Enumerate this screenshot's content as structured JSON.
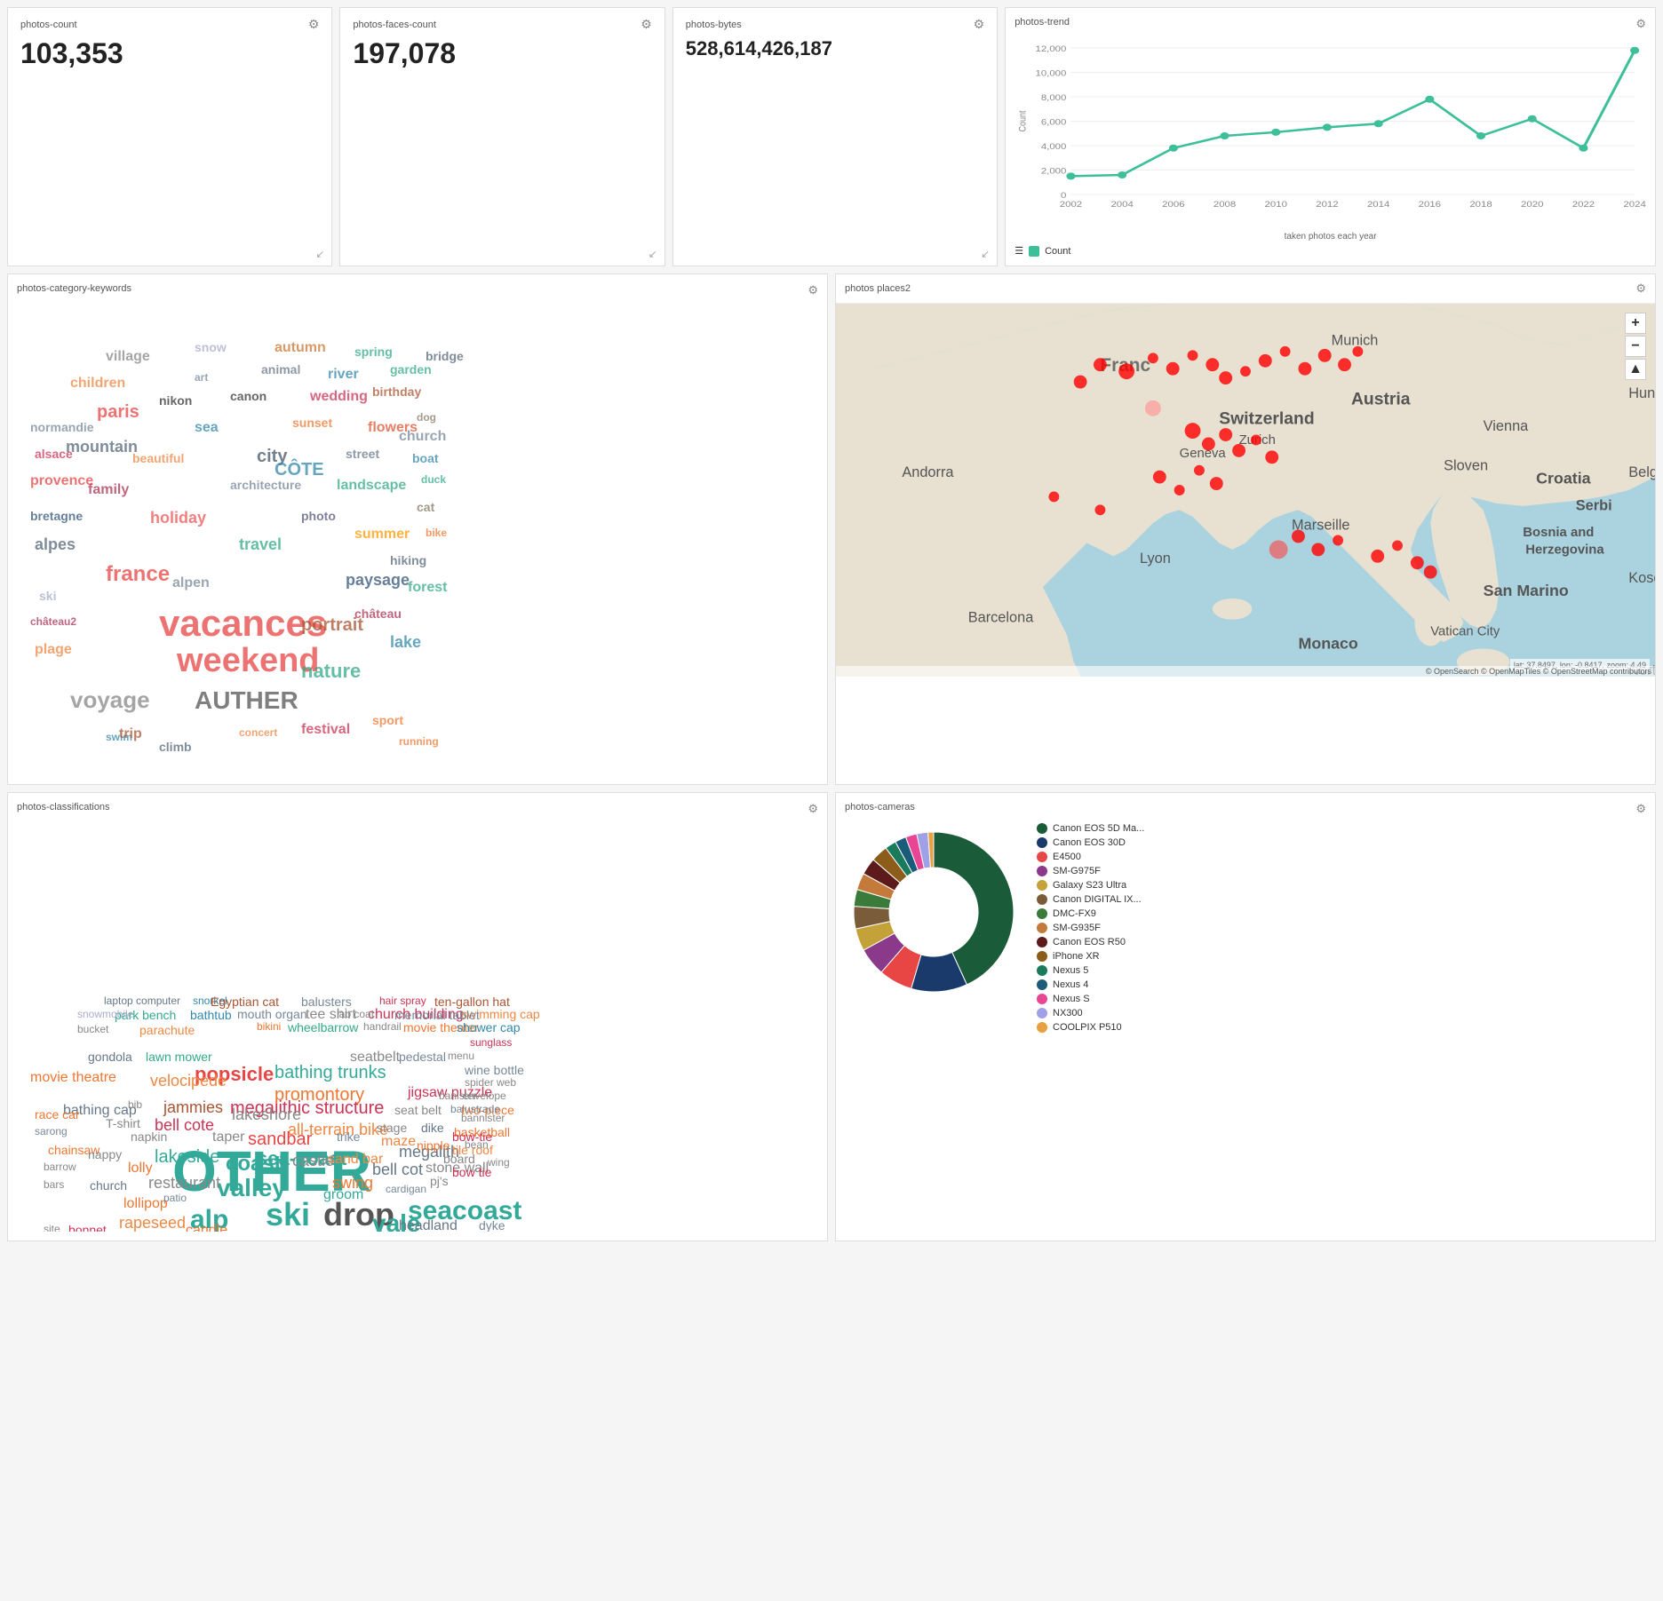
{
  "stats": {
    "photos_count": {
      "title": "photos-count",
      "value": "103,353"
    },
    "photos_faces_count": {
      "title": "photos-faces-count",
      "value": "197,078"
    },
    "photos_bytes": {
      "title": "photos-bytes",
      "value": "528,614,426,187"
    }
  },
  "trend": {
    "title": "photos-trend",
    "x_label": "taken photos each year",
    "y_label": "Count",
    "legend": "Count",
    "data": [
      {
        "year": 2002,
        "count": 1500
      },
      {
        "year": 2004,
        "count": 1600
      },
      {
        "year": 2006,
        "count": 3800
      },
      {
        "year": 2008,
        "count": 4800
      },
      {
        "year": 2010,
        "count": 5100
      },
      {
        "year": 2012,
        "count": 5500
      },
      {
        "year": 2014,
        "count": 5800
      },
      {
        "year": 2016,
        "count": 7800
      },
      {
        "year": 2018,
        "count": 4800
      },
      {
        "year": 2020,
        "count": 6200
      },
      {
        "year": 2022,
        "count": 3800
      },
      {
        "year": 2024,
        "count": 11800
      }
    ],
    "y_ticks": [
      0,
      2000,
      4000,
      6000,
      8000,
      10000,
      12000
    ]
  },
  "wordcloud_title": "photos-category-keywords",
  "places_title": "photos places2",
  "map_coords": "lat: 37.8497, lon: -0.8417, zoom: 4.49",
  "map_attribution": "© OpenSearch © OpenMapTiles © OpenStreetMap contributors",
  "classifications_title": "photos-classifications",
  "cameras_title": "photos-cameras",
  "cameras": [
    {
      "name": "Canon EOS 5D Ma...",
      "color": "#1a5c3a",
      "pct": 38
    },
    {
      "name": "Canon EOS 30D",
      "color": "#1a3a6c",
      "pct": 10
    },
    {
      "name": "E4500",
      "color": "#e84545",
      "pct": 6
    },
    {
      "name": "SM-G975F",
      "color": "#8b3a8b",
      "pct": 5
    },
    {
      "name": "Galaxy S23 Ultra",
      "color": "#c4a23a",
      "pct": 4
    },
    {
      "name": "Canon DIGITAL IX...",
      "color": "#7a5c3a",
      "pct": 4
    },
    {
      "name": "DMC-FX9",
      "color": "#3a7a3a",
      "pct": 3
    },
    {
      "name": "SM-G935F",
      "color": "#c47a3a",
      "pct": 3
    },
    {
      "name": "Canon EOS R50",
      "color": "#5c1a1a",
      "pct": 3
    },
    {
      "name": "iPhone XR",
      "color": "#8b5c1a",
      "pct": 3
    },
    {
      "name": "Nexus 5",
      "color": "#1a7a5c",
      "pct": 2
    },
    {
      "name": "Nexus 4",
      "color": "#1a5c7a",
      "pct": 2
    },
    {
      "name": "Nexus S",
      "color": "#e84595",
      "pct": 2
    },
    {
      "name": "NX300",
      "color": "#a0a0e8",
      "pct": 2
    },
    {
      "name": "COOLPIX P510",
      "color": "#e8a040",
      "pct": 1
    }
  ],
  "gear_icon": "⚙",
  "plus_icon": "+",
  "minus_icon": "−",
  "reset_icon": "▲"
}
